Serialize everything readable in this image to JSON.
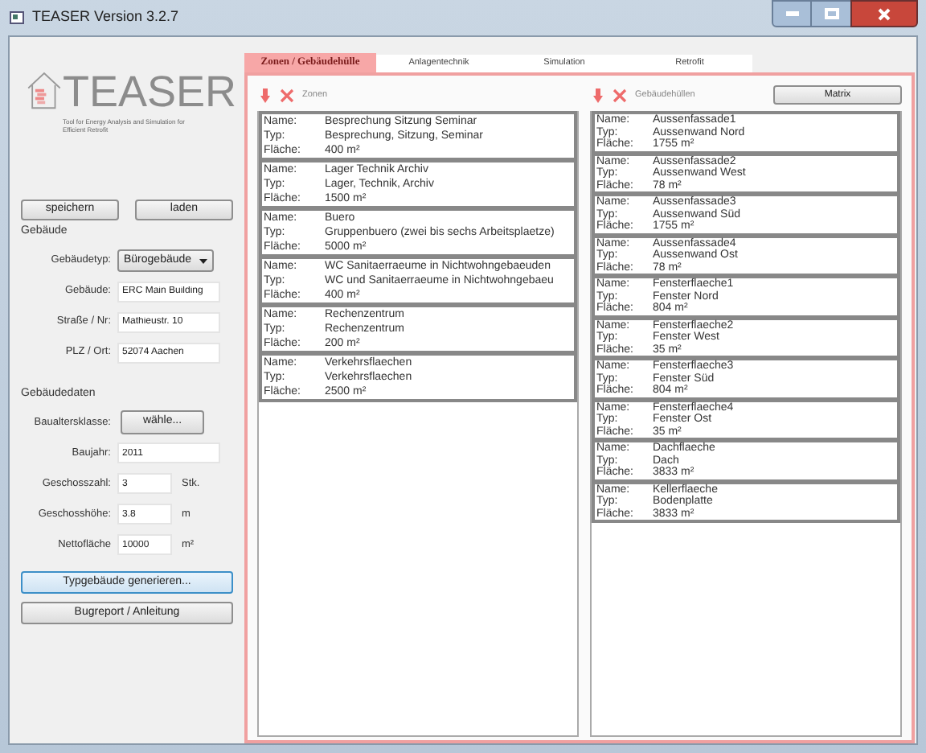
{
  "window": {
    "title": "TEASER Version 3.2.7"
  },
  "logo": {
    "name": "TEASER",
    "tagline": "Tool for Energy Analysis and Simulation for Efficient Retrofit"
  },
  "file_buttons": [
    "speichern",
    "laden"
  ],
  "building": {
    "title": "Gebäude",
    "fields": [
      {
        "kind": "select",
        "label": "Gebäudetyp:",
        "value": "Bürogebäude"
      },
      {
        "kind": "text",
        "label": "Gebäude:",
        "value": "ERC Main Building"
      },
      {
        "kind": "text",
        "label": "Straße / Nr:",
        "value": "Mathieustr. 10"
      },
      {
        "kind": "text",
        "label": "PLZ / Ort:",
        "value": "52074 Aachen"
      }
    ]
  },
  "building_data": {
    "title": "Gebäudedaten",
    "fields": [
      {
        "kind": "button",
        "label": "Baualtersklasse:",
        "value": "wähle..."
      },
      {
        "kind": "text",
        "label": "Baujahr:",
        "value": "2011"
      },
      {
        "kind": "text",
        "label": "Geschosszahl:",
        "value": "3",
        "unit": "Stk."
      },
      {
        "kind": "text",
        "label": "Geschosshöhe:",
        "value": "3.8",
        "unit": "m"
      },
      {
        "kind": "text",
        "label": "Nettofläche",
        "value": "10000",
        "unit": "m²"
      }
    ]
  },
  "bottom_buttons": [
    {
      "label": "Typgebäude generieren...",
      "focused": true
    },
    {
      "label": "Bugreport / Anleitung",
      "focused": false
    }
  ],
  "tabs": [
    {
      "label": "Zonen / Gebäudehülle",
      "selected": true
    },
    {
      "label": "Anlagentechnik",
      "selected": false
    },
    {
      "label": "Simulation",
      "selected": false
    },
    {
      "label": "Retrofit",
      "selected": false
    }
  ],
  "zones": {
    "title": "Zonen",
    "items": [
      {
        "fields": [
          {
            "label": "Name:",
            "value": "Besprechung Sitzung Seminar"
          },
          {
            "label": "Typ:",
            "value": "Besprechung, Sitzung, Seminar"
          },
          {
            "label": "Fläche:",
            "value": "400 m²"
          }
        ]
      },
      {
        "fields": [
          {
            "label": "Name:",
            "value": "Lager Technik Archiv"
          },
          {
            "label": "Typ:",
            "value": "Lager, Technik, Archiv"
          },
          {
            "label": "Fläche:",
            "value": "1500 m²"
          }
        ]
      },
      {
        "fields": [
          {
            "label": "Name:",
            "value": "Buero"
          },
          {
            "label": "Typ:",
            "value": "Gruppenbuero (zwei bis sechs Arbeitsplaetze)"
          },
          {
            "label": "Fläche:",
            "value": "5000 m²"
          }
        ]
      },
      {
        "fields": [
          {
            "label": "Name:",
            "value": "WC Sanitaerraeume in Nichtwohngebaeuden"
          },
          {
            "label": "Typ:",
            "value": "WC und Sanitaerraeume in Nichtwohngebaeu"
          },
          {
            "label": "Fläche:",
            "value": "400 m²"
          }
        ]
      },
      {
        "fields": [
          {
            "label": "Name:",
            "value": "Rechenzentrum"
          },
          {
            "label": "Typ:",
            "value": "Rechenzentrum"
          },
          {
            "label": "Fläche:",
            "value": "200 m²"
          }
        ]
      },
      {
        "fields": [
          {
            "label": "Name:",
            "value": "Verkehrsflaechen"
          },
          {
            "label": "Typ:",
            "value": "Verkehrsflaechen"
          },
          {
            "label": "Fläche:",
            "value": "2500 m²"
          }
        ]
      }
    ]
  },
  "envelopes": {
    "title": "Gebäudehüllen",
    "button": "Matrix",
    "items": [
      {
        "fields": [
          {
            "label": "Name:",
            "value": "Aussenfassade1"
          },
          {
            "label": "Typ:",
            "value": "Aussenwand Nord"
          },
          {
            "label": "Fläche:",
            "value": "1755 m²"
          }
        ]
      },
      {
        "fields": [
          {
            "label": "Name:",
            "value": "Aussenfassade2"
          },
          {
            "label": "Typ:",
            "value": "Aussenwand West"
          },
          {
            "label": "Fläche:",
            "value": "78 m²"
          }
        ]
      },
      {
        "fields": [
          {
            "label": "Name:",
            "value": "Aussenfassade3"
          },
          {
            "label": "Typ:",
            "value": "Aussenwand Süd"
          },
          {
            "label": "Fläche:",
            "value": "1755 m²"
          }
        ]
      },
      {
        "fields": [
          {
            "label": "Name:",
            "value": "Aussenfassade4"
          },
          {
            "label": "Typ:",
            "value": "Aussenwand Ost"
          },
          {
            "label": "Fläche:",
            "value": "78 m²"
          }
        ]
      },
      {
        "fields": [
          {
            "label": "Name:",
            "value": "Fensterflaeche1"
          },
          {
            "label": "Typ:",
            "value": "Fenster Nord"
          },
          {
            "label": "Fläche:",
            "value": "804 m²"
          }
        ]
      },
      {
        "fields": [
          {
            "label": "Name:",
            "value": "Fensterflaeche2"
          },
          {
            "label": "Typ:",
            "value": "Fenster West"
          },
          {
            "label": "Fläche:",
            "value": "35 m²"
          }
        ]
      },
      {
        "fields": [
          {
            "label": "Name:",
            "value": "Fensterflaeche3"
          },
          {
            "label": "Typ:",
            "value": "Fenster Süd"
          },
          {
            "label": "Fläche:",
            "value": "804 m²"
          }
        ]
      },
      {
        "fields": [
          {
            "label": "Name:",
            "value": "Fensterflaeche4"
          },
          {
            "label": "Typ:",
            "value": "Fenster Ost"
          },
          {
            "label": "Fläche:",
            "value": "35 m²"
          }
        ]
      },
      {
        "fields": [
          {
            "label": "Name:",
            "value": "Dachflaeche"
          },
          {
            "label": "Typ:",
            "value": "Dach"
          },
          {
            "label": "Fläche:",
            "value": "3833 m²"
          }
        ]
      },
      {
        "fields": [
          {
            "label": "Name:",
            "value": "Kellerflaeche"
          },
          {
            "label": "Typ:",
            "value": "Bodenplatte"
          },
          {
            "label": "Fläche:",
            "value": "3833 m²"
          }
        ]
      }
    ]
  }
}
